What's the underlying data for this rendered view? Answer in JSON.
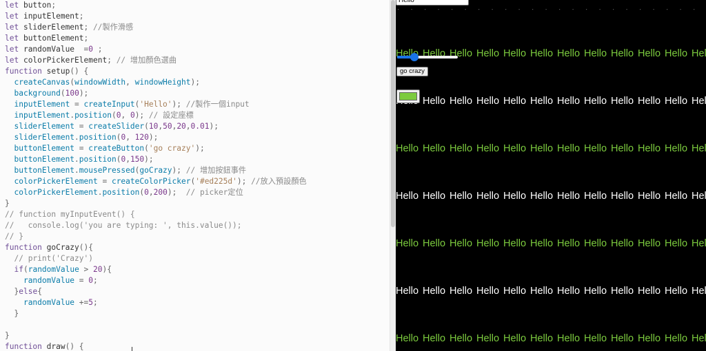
{
  "editor": {
    "lines": [
      [
        [
          "kw",
          "let"
        ],
        [
          "id",
          " button"
        ],
        [
          "p",
          ";"
        ]
      ],
      [
        [
          "kw",
          "let"
        ],
        [
          "id",
          " inputElement"
        ],
        [
          "p",
          ";"
        ]
      ],
      [
        [
          "kw",
          "let"
        ],
        [
          "id",
          " sliderElement"
        ],
        [
          "p",
          "; "
        ],
        [
          "cm",
          "//製作滑感"
        ]
      ],
      [
        [
          "kw",
          "let"
        ],
        [
          "id",
          " buttonElement"
        ],
        [
          "p",
          ";"
        ]
      ],
      [
        [
          "kw",
          "let"
        ],
        [
          "id",
          " randomValue  "
        ],
        [
          "p",
          "="
        ],
        [
          "num",
          "0"
        ],
        [
          "p",
          " ;"
        ]
      ],
      [
        [
          "kw",
          "let"
        ],
        [
          "id",
          " colorPickerElement"
        ],
        [
          "p",
          "; "
        ],
        [
          "cm",
          "// 增加顏色選曲"
        ]
      ],
      [
        [
          "kw",
          "function"
        ],
        [
          "id",
          " setup"
        ],
        [
          "p",
          "() {"
        ]
      ],
      [
        [
          "id",
          "  "
        ],
        [
          "fn",
          "createCanvas"
        ],
        [
          "p",
          "("
        ],
        [
          "fn",
          "windowWidth"
        ],
        [
          "p",
          ", "
        ],
        [
          "fn",
          "windowHeight"
        ],
        [
          "p",
          ");"
        ]
      ],
      [
        [
          "id",
          "  "
        ],
        [
          "fn",
          "background"
        ],
        [
          "p",
          "("
        ],
        [
          "num",
          "100"
        ],
        [
          "p",
          ");"
        ]
      ],
      [
        [
          "id",
          "  "
        ],
        [
          "fn",
          "inputElement"
        ],
        [
          "p",
          " = "
        ],
        [
          "fn",
          "createInput"
        ],
        [
          "p",
          "("
        ],
        [
          "str",
          "'Hello'"
        ],
        [
          "p",
          "); "
        ],
        [
          "cm",
          "//製作一個input"
        ]
      ],
      [
        [
          "id",
          "  "
        ],
        [
          "fn",
          "inputElement"
        ],
        [
          "p",
          "."
        ],
        [
          "fn",
          "position"
        ],
        [
          "p",
          "("
        ],
        [
          "num",
          "0"
        ],
        [
          "p",
          ", "
        ],
        [
          "num",
          "0"
        ],
        [
          "p",
          "); "
        ],
        [
          "cm",
          "// 設定座標"
        ]
      ],
      [
        [
          "id",
          "  "
        ],
        [
          "fn",
          "sliderElement"
        ],
        [
          "p",
          " = "
        ],
        [
          "fn",
          "createSlider"
        ],
        [
          "p",
          "("
        ],
        [
          "num",
          "10"
        ],
        [
          "p",
          ","
        ],
        [
          "num",
          "50"
        ],
        [
          "p",
          ","
        ],
        [
          "num",
          "20"
        ],
        [
          "p",
          ","
        ],
        [
          "num",
          "0.01"
        ],
        [
          "p",
          ");"
        ]
      ],
      [
        [
          "id",
          "  "
        ],
        [
          "fn",
          "sliderElement"
        ],
        [
          "p",
          "."
        ],
        [
          "fn",
          "position"
        ],
        [
          "p",
          "("
        ],
        [
          "num",
          "0"
        ],
        [
          "p",
          ", "
        ],
        [
          "num",
          "120"
        ],
        [
          "p",
          ");"
        ]
      ],
      [
        [
          "id",
          "  "
        ],
        [
          "fn",
          "buttonElement"
        ],
        [
          "p",
          " = "
        ],
        [
          "fn",
          "createButton"
        ],
        [
          "p",
          "("
        ],
        [
          "str",
          "'go crazy'"
        ],
        [
          "p",
          ");"
        ]
      ],
      [
        [
          "id",
          "  "
        ],
        [
          "fn",
          "buttonElement"
        ],
        [
          "p",
          "."
        ],
        [
          "fn",
          "position"
        ],
        [
          "p",
          "("
        ],
        [
          "num",
          "0"
        ],
        [
          "p",
          ","
        ],
        [
          "num",
          "150"
        ],
        [
          "p",
          ");"
        ]
      ],
      [
        [
          "id",
          "  "
        ],
        [
          "fn",
          "buttonElement"
        ],
        [
          "p",
          "."
        ],
        [
          "fn",
          "mousePressed"
        ],
        [
          "p",
          "("
        ],
        [
          "fn",
          "goCrazy"
        ],
        [
          "p",
          "); "
        ],
        [
          "cm",
          "// 增加按鈕事件"
        ]
      ],
      [
        [
          "id",
          "  "
        ],
        [
          "fn",
          "colorPickerElement"
        ],
        [
          "p",
          " = "
        ],
        [
          "fn",
          "createColorPicker"
        ],
        [
          "p",
          "("
        ],
        [
          "str",
          "'#ed225d'"
        ],
        [
          "p",
          "); "
        ],
        [
          "cm",
          "//放入預設顏色"
        ]
      ],
      [
        [
          "id",
          "  "
        ],
        [
          "fn",
          "colorPickerElement"
        ],
        [
          "p",
          "."
        ],
        [
          "fn",
          "position"
        ],
        [
          "p",
          "("
        ],
        [
          "num",
          "0"
        ],
        [
          "p",
          ","
        ],
        [
          "num",
          "200"
        ],
        [
          "p",
          ");  "
        ],
        [
          "cm",
          "// picker定位"
        ]
      ],
      [
        [
          "p",
          "}"
        ]
      ],
      [
        [
          "cm",
          "// function myInputEvent() {"
        ]
      ],
      [
        [
          "cm",
          "//   console.log('you are typing: ', this.value());"
        ]
      ],
      [
        [
          "cm",
          "// }"
        ]
      ],
      [
        [
          "kw",
          "function"
        ],
        [
          "id",
          " goCrazy"
        ],
        [
          "p",
          "(){"
        ]
      ],
      [
        [
          "id",
          "  "
        ],
        [
          "cm",
          "// print('Crazy')"
        ]
      ],
      [
        [
          "id",
          "  "
        ],
        [
          "kw",
          "if"
        ],
        [
          "p",
          "("
        ],
        [
          "fn",
          "randomValue"
        ],
        [
          "p",
          " > "
        ],
        [
          "num",
          "20"
        ],
        [
          "p",
          "){"
        ]
      ],
      [
        [
          "id",
          "    "
        ],
        [
          "fn",
          "randomValue"
        ],
        [
          "p",
          " = "
        ],
        [
          "num",
          "0"
        ],
        [
          "p",
          ";"
        ]
      ],
      [
        [
          "id",
          "  "
        ],
        [
          "p",
          "}"
        ],
        [
          "kw",
          "else"
        ],
        [
          "p",
          "{"
        ]
      ],
      [
        [
          "id",
          "    "
        ],
        [
          "fn",
          "randomValue"
        ],
        [
          "p",
          " +="
        ],
        [
          "num",
          "5"
        ],
        [
          "p",
          ";"
        ]
      ],
      [
        [
          "id",
          "  "
        ],
        [
          "p",
          "}"
        ]
      ],
      [
        [
          "id",
          ""
        ]
      ],
      [
        [
          "p",
          "}"
        ]
      ],
      [
        [
          "kw",
          "function"
        ],
        [
          "id",
          " draw"
        ],
        [
          "p",
          "() {"
        ]
      ]
    ]
  },
  "preview": {
    "input_value": "Hello",
    "button_label": "go crazy",
    "slider_value": 20,
    "slider_min": 10,
    "slider_max": 50,
    "picker_color": "#7ccb3e",
    "hello_text": "Hello",
    "colors": {
      "green": "#7ccb3e",
      "white": "#ffffff",
      "background": "#000000"
    },
    "rows": [
      "green",
      "white",
      "green",
      "white",
      "green",
      "white",
      "green"
    ]
  }
}
